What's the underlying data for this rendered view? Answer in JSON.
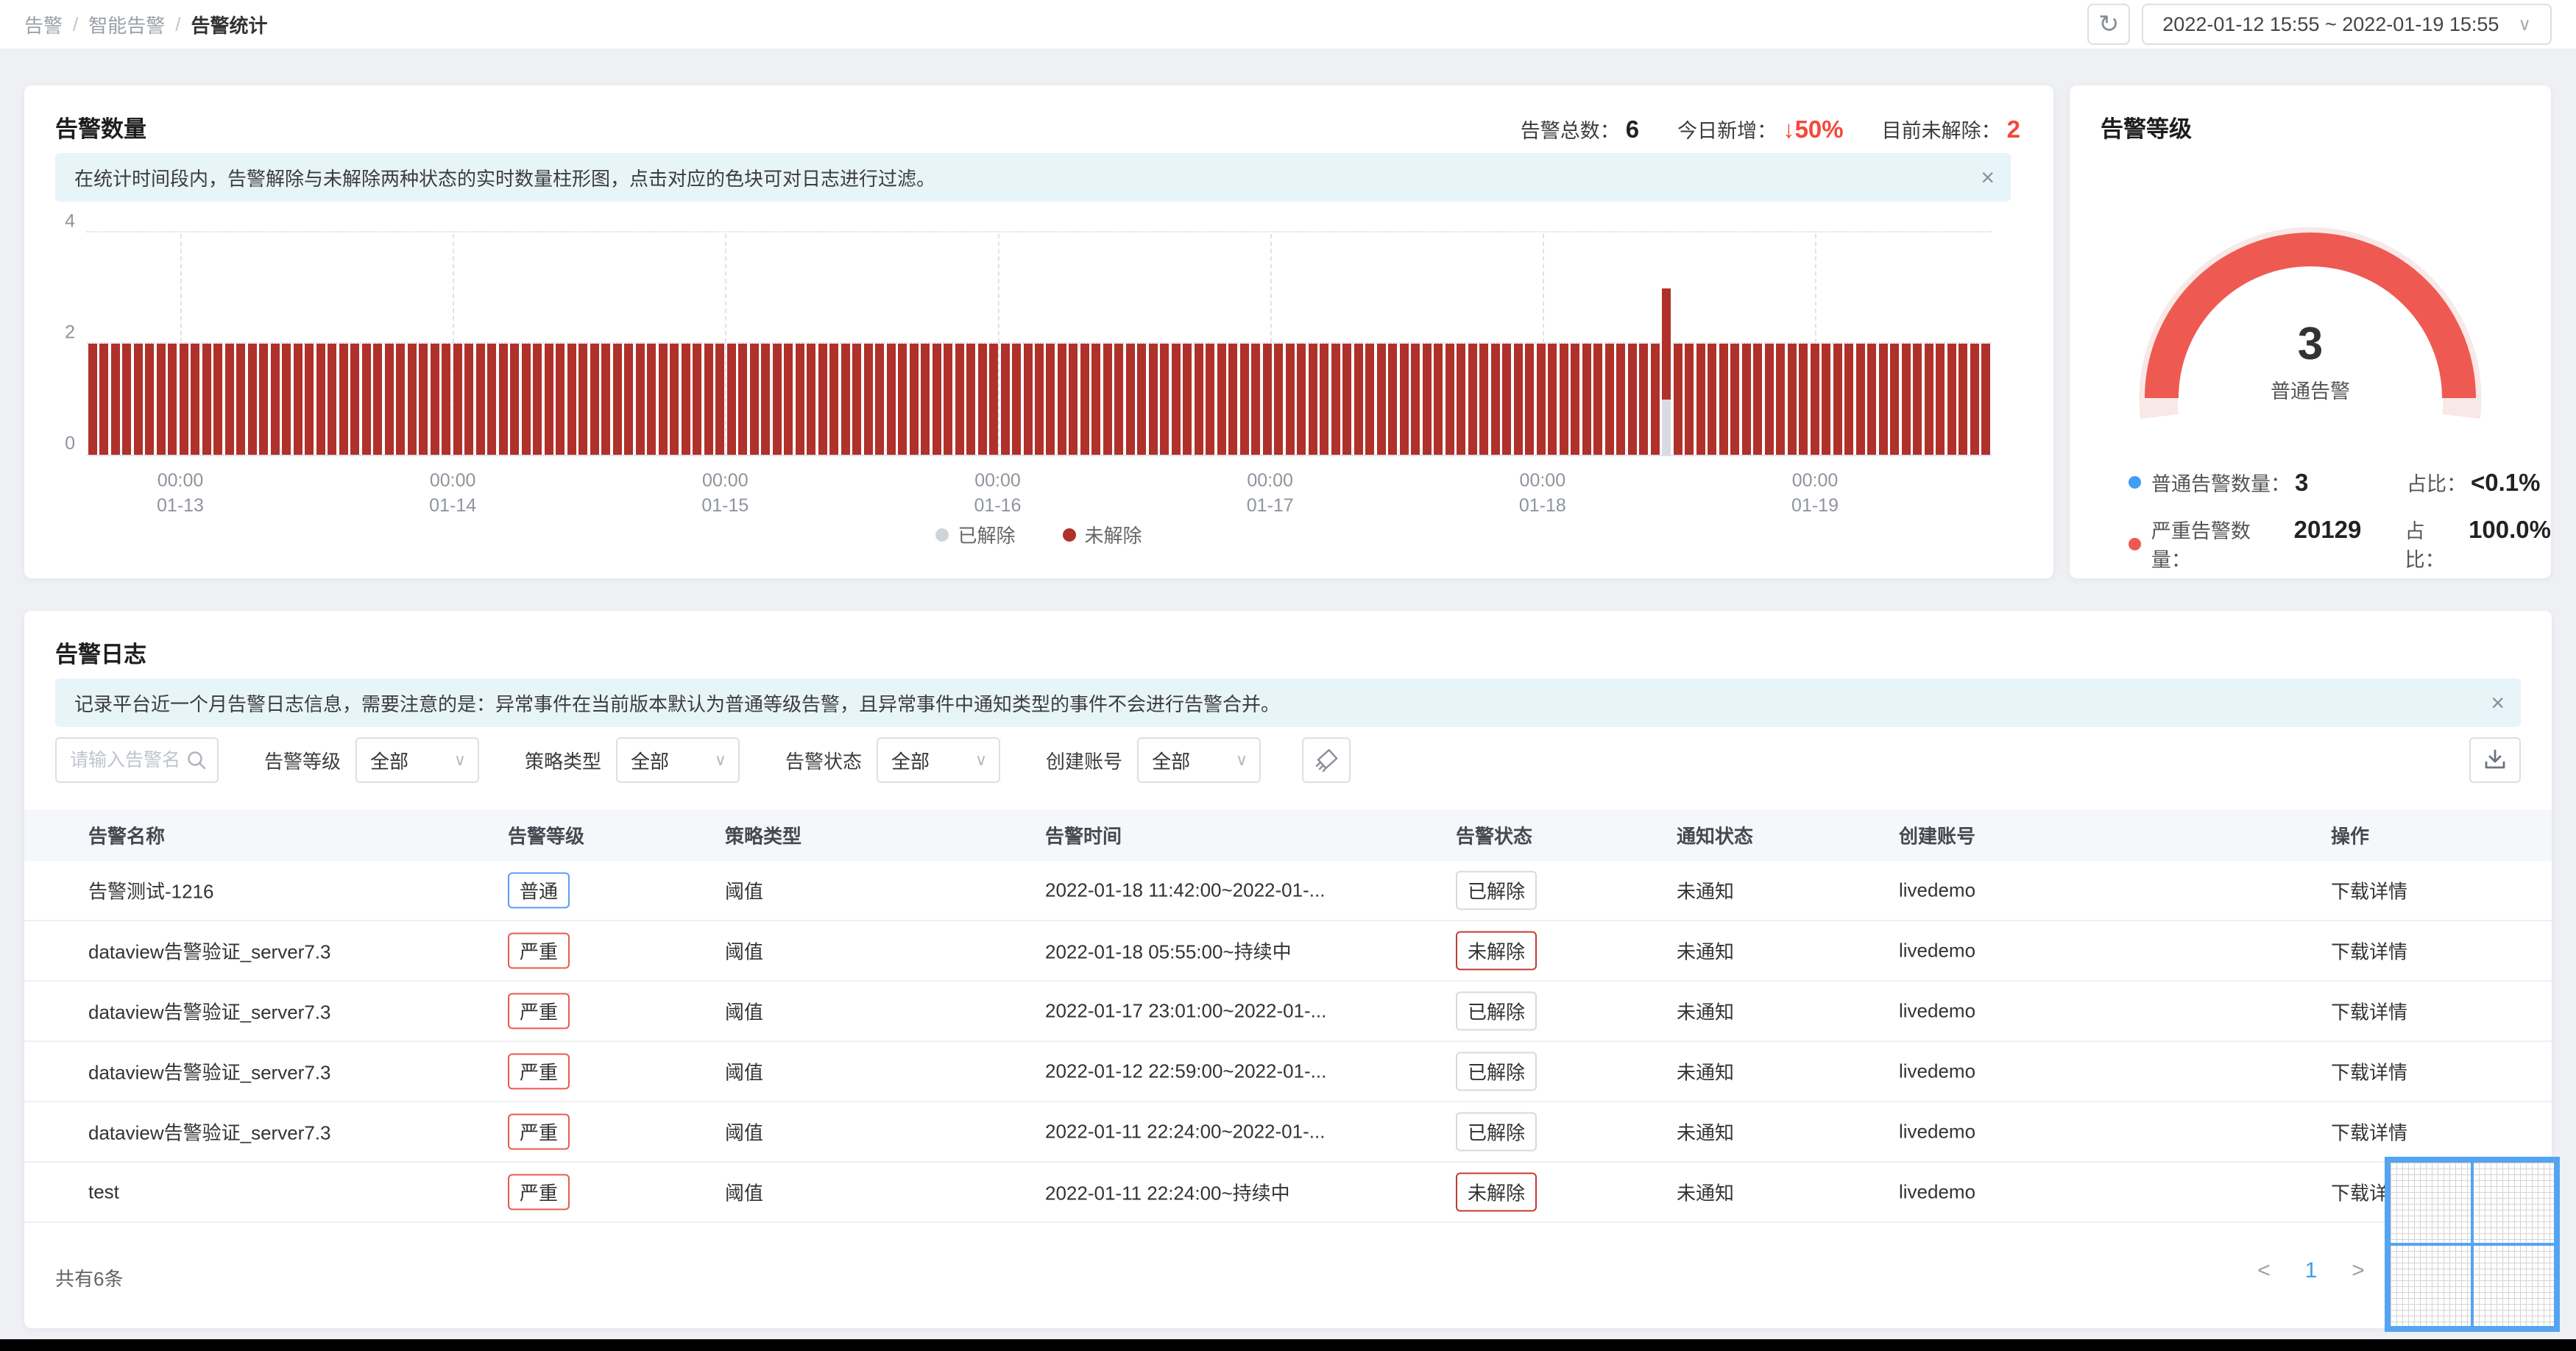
{
  "breadcrumb": {
    "items": [
      {
        "label": "告警",
        "current": false
      },
      {
        "label": "智能告警",
        "current": false
      },
      {
        "label": "告警统计",
        "current": true
      }
    ],
    "separator": "/"
  },
  "topbar": {
    "refresh_icon": "↻",
    "date_range": "2022-01-12 15:55 ~ 2022-01-19 15:55",
    "date_chevron": "∨"
  },
  "alert_count": {
    "title": "告警数量",
    "stats": {
      "total_label": "告警总数：",
      "total_value": "6",
      "new_label": "今日新增：",
      "new_value": "↓50%",
      "unresolved_label": "目前未解除：",
      "unresolved_value": "2"
    },
    "banner": {
      "text": "在统计时间段内，告警解除与未解除两种状态的实时数量柱形图，点击对应的色块可对日志进行过滤。",
      "close_icon": "×"
    },
    "chart_data": {
      "type": "bar",
      "stacked": true,
      "x_start": "2022-01-12 16:00",
      "x_end": "2022-01-19 15:00",
      "interval": "1h",
      "bar_count": 167,
      "ylim": [
        0,
        4
      ],
      "yticks": [
        0,
        2,
        4
      ],
      "x_tick_labels": [
        [
          "00:00",
          "01-13"
        ],
        [
          "00:00",
          "01-14"
        ],
        [
          "00:00",
          "01-15"
        ],
        [
          "00:00",
          "01-16"
        ],
        [
          "00:00",
          "01-17"
        ],
        [
          "00:00",
          "01-18"
        ],
        [
          "00:00",
          "01-19"
        ]
      ],
      "series": [
        {
          "name": "已解除",
          "color": "#d8dce0",
          "values": {
            "default": 0,
            "exceptions": {
              "138": 1
            }
          }
        },
        {
          "name": "未解除",
          "color": "#b0302a",
          "values": {
            "default": 2,
            "exceptions": {}
          }
        }
      ],
      "legend": [
        {
          "name": "已解除",
          "dot_color": "#cfd4d9"
        },
        {
          "name": "未解除",
          "dot_color": "#b0302a"
        }
      ],
      "legend_position": "bottom",
      "grid": true
    }
  },
  "alert_level": {
    "title": "告警等级",
    "chart_data": {
      "type": "gauge",
      "center_value": "3",
      "center_label": "普通告警",
      "arc_color": "#ee5a52",
      "track_color": "#f8e8e7",
      "segments": [
        {
          "name": "普通告警",
          "count": 3,
          "ratio": "<0.1%",
          "color": "#3f9ef5"
        },
        {
          "name": "严重告警",
          "count": 20129,
          "ratio": "100.0%",
          "color": "#ee5a52"
        }
      ]
    },
    "legend_rows": [
      {
        "dot_color": "#3f9ef5",
        "label": "普通告警数量：",
        "value": "3",
        "ratio_label": "占比：",
        "ratio": "<0.1%"
      },
      {
        "dot_color": "#ee5a52",
        "label": "严重告警数量：",
        "value": "20129",
        "ratio_label": "占比：",
        "ratio": "100.0%"
      }
    ]
  },
  "alert_log": {
    "title": "告警日志",
    "banner": {
      "text": "记录平台近一个月告警日志信息，需要注意的是：异常事件在当前版本默认为普通等级告警，且异常事件中通知类型的事件不会进行告警合并。",
      "close_icon": "×"
    },
    "filters": {
      "search": {
        "placeholder": "请输入告警名称"
      },
      "selects": [
        {
          "key": "alert-level",
          "label": "告警等级",
          "value": "全部"
        },
        {
          "key": "policy-type",
          "label": "策略类型",
          "value": "全部"
        },
        {
          "key": "alert-status",
          "label": "告警状态",
          "value": "全部"
        },
        {
          "key": "create-account",
          "label": "创建账号",
          "value": "全部"
        }
      ],
      "chevron": "∨"
    },
    "table": {
      "columns": [
        {
          "key": "name",
          "label": "告警名称"
        },
        {
          "key": "level",
          "label": "告警等级"
        },
        {
          "key": "type",
          "label": "策略类型"
        },
        {
          "key": "time",
          "label": "告警时间"
        },
        {
          "key": "status",
          "label": "告警状态"
        },
        {
          "key": "notify",
          "label": "通知状态"
        },
        {
          "key": "account",
          "label": "创建账号"
        },
        {
          "key": "action",
          "label": "操作"
        }
      ],
      "rows": [
        {
          "name": "告警测试-1216",
          "level": "普通",
          "type": "阈值",
          "time": "2022-01-18 11:42:00~2022-01-...",
          "status": "已解除",
          "notify": "未通知",
          "account": "livedemo",
          "action": "下载详情"
        },
        {
          "name": "dataview告警验证_server7.3",
          "level": "严重",
          "type": "阈值",
          "time": "2022-01-18 05:55:00~持续中",
          "status": "未解除",
          "notify": "未通知",
          "account": "livedemo",
          "action": "下载详情"
        },
        {
          "name": "dataview告警验证_server7.3",
          "level": "严重",
          "type": "阈值",
          "time": "2022-01-17 23:01:00~2022-01-...",
          "status": "已解除",
          "notify": "未通知",
          "account": "livedemo",
          "action": "下载详情"
        },
        {
          "name": "dataview告警验证_server7.3",
          "level": "严重",
          "type": "阈值",
          "time": "2022-01-12 22:59:00~2022-01-...",
          "status": "已解除",
          "notify": "未通知",
          "account": "livedemo",
          "action": "下载详情"
        },
        {
          "name": "dataview告警验证_server7.3",
          "level": "严重",
          "type": "阈值",
          "time": "2022-01-11 22:24:00~2022-01-...",
          "status": "已解除",
          "notify": "未通知",
          "account": "livedemo",
          "action": "下载详情"
        },
        {
          "name": "test",
          "level": "严重",
          "type": "阈值",
          "time": "2022-01-11 22:24:00~持续中",
          "status": "未解除",
          "notify": "未通知",
          "account": "livedemo",
          "action": "下载详情"
        }
      ]
    },
    "footer": {
      "total_text": "共有6条"
    },
    "pagination": {
      "prev_icon": "<",
      "page": "1",
      "next_icon": ">"
    }
  },
  "colors": {
    "bar_unresolved": "#b0302a",
    "bar_resolved": "#d8dce0",
    "link": "#55aedd",
    "badge_normal": "#5b9cf8",
    "badge_severe": "#e85a50",
    "status_unresolved": "#c23b32",
    "banner_bg": "#e7f5f9",
    "stat_red": "#f5473b"
  }
}
